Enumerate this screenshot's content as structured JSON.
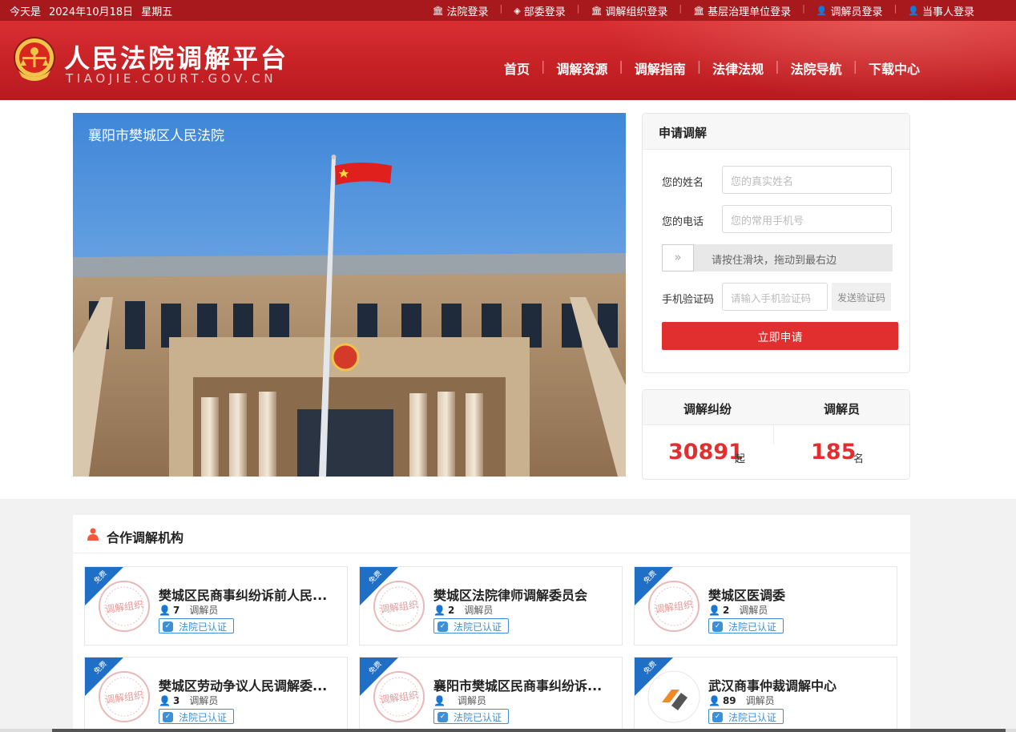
{
  "topbar": {
    "date_prefix": "今天是",
    "date": "2024年10月18日",
    "weekday": "星期五",
    "links": [
      {
        "icon": "court-building-icon",
        "label": "法院登录"
      },
      {
        "icon": "layers-icon",
        "label": "部委登录"
      },
      {
        "icon": "court-building-icon",
        "label": "调解组织登录"
      },
      {
        "icon": "court-building-icon",
        "label": "基层治理单位登录"
      },
      {
        "icon": "person-icon",
        "label": "调解员登录"
      },
      {
        "icon": "person-icon",
        "label": "当事人登录"
      }
    ]
  },
  "header": {
    "title": "人民法院调解平台",
    "subtitle": "TIAOJIE.COURT.GOV.CN",
    "nav": [
      "首页",
      "调解资源",
      "调解指南",
      "法律法规",
      "法院导航",
      "下载中心"
    ]
  },
  "banner": {
    "caption": "襄阳市樊城区人民法院"
  },
  "apply_form": {
    "title": "申请调解",
    "name_label": "您的姓名",
    "name_placeholder": "您的真实姓名",
    "phone_label": "您的电话",
    "phone_placeholder": "您的常用手机号",
    "slider_text": "请按住滑块，拖动到最右边",
    "slider_handle": "»",
    "code_label": "手机验证码",
    "code_placeholder": "请输入手机验证码",
    "send_code": "发送验证码",
    "submit": "立即申请"
  },
  "stats": {
    "disputes_label": "调解纠纷",
    "disputes_value": "30891",
    "disputes_unit": "起",
    "mediators_label": "调解员",
    "mediators_value": "185",
    "mediators_unit": "名"
  },
  "partners": {
    "title": "合作调解机构",
    "corner_tag": "免费",
    "seal_text": "调解组织",
    "mediator_word": "调解员",
    "certified": "法院已认证",
    "orgs": [
      {
        "name": "樊城区民商事纠纷诉前人民...",
        "count": "7"
      },
      {
        "name": "樊城区法院律师调解委员会",
        "count": "2"
      },
      {
        "name": "樊城区医调委",
        "count": "2"
      },
      {
        "name": "樊城区劳动争议人民调解委...",
        "count": "3"
      },
      {
        "name": "襄阳市樊城区民商事纠纷诉...",
        "count": ""
      },
      {
        "name": "武汉商事仲裁调解中心",
        "count": "89"
      }
    ]
  },
  "colors": {
    "brand_red": "#c72226",
    "topbar_red": "#a8191d",
    "accent_red": "#e12f2f",
    "badge_blue": "#3d8fd8"
  }
}
